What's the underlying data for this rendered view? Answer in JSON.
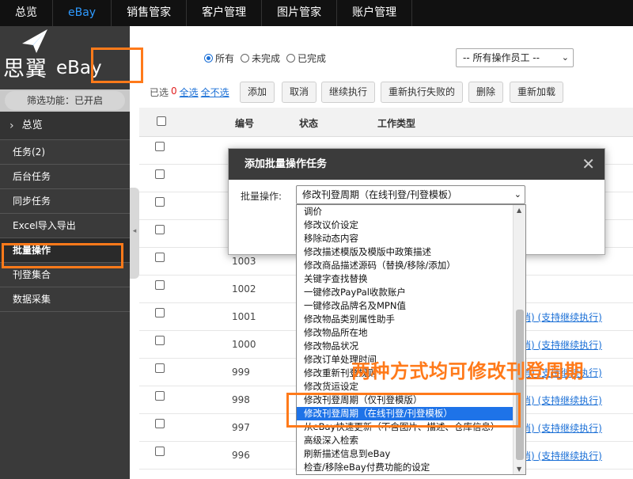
{
  "topnav": {
    "items": [
      "总览",
      "eBay",
      "销售管家",
      "客户管理",
      "图片管家",
      "账户管理"
    ],
    "active": "eBay"
  },
  "sidebar": {
    "logo_text": "思翼",
    "logo_ebay": "eBay",
    "filter": "筛选功能：已开启",
    "overview": "总览",
    "items": [
      "任务(2)",
      "后台任务",
      "同步任务",
      "Excel导入导出",
      "批量操作",
      "刊登集合",
      "数据采集"
    ],
    "active": "批量操作"
  },
  "filters": {
    "radios": [
      "所有",
      "未完成",
      "已完成"
    ],
    "selected_radio": "所有",
    "staff_select": "-- 所有操作员工 --"
  },
  "toolbar": {
    "selected_label": "已选",
    "selected_count": "0",
    "select_all": "全选",
    "select_none": "全不选",
    "buttons": [
      "添加",
      "取消",
      "继续执行",
      "重新执行失败的",
      "删除",
      "重新加载"
    ]
  },
  "table": {
    "headers": [
      "编号",
      "状态",
      "工作类型"
    ],
    "rows": [
      {
        "num": "",
        "actions": ""
      },
      {
        "num": "",
        "actions": ""
      },
      {
        "num": "",
        "actions": ""
      },
      {
        "num": "",
        "actions": ""
      },
      {
        "num": "1003",
        "actions": ""
      },
      {
        "num": "1002",
        "actions": ""
      },
      {
        "num": "1001",
        "actions": "取消) (支持继续执行)"
      },
      {
        "num": "1000",
        "actions": "取消) (支持继续执行)"
      },
      {
        "num": "999",
        "actions": "取消) (支持继续执行)"
      },
      {
        "num": "998",
        "actions": "取消) (支持继续执行)"
      },
      {
        "num": "997",
        "actions": "取消) (支持继续执行)"
      },
      {
        "num": "996",
        "actions": "取消) (支持继续执行)"
      }
    ]
  },
  "modal": {
    "title": "添加批量操作任务",
    "label": "批量操作:",
    "selected": "修改刊登周期（在线刊登/刊登模板）"
  },
  "dropdown": {
    "options": [
      "调价",
      "修改议价设定",
      "移除动态内容",
      "修改描述模版及模版中政策描述",
      "修改商品描述源码（替换/移除/添加）",
      "关键字查找替换",
      "一键修改PayPal收款账户",
      "一键修改品牌名及MPN值",
      "修改物品类别属性助手",
      "修改物品所在地",
      "修改物品状况",
      "修改订单处理时间",
      "修改重新刊登规则",
      "修改货运设定",
      "修改刊登周期（仅刊登模版）",
      "修改刊登周期（在线刊登/刊登模板）",
      "从eBay快速更新（不含图片、描述、仓库信息）",
      "高级深入检索",
      "刷新描述信息到eBay",
      "检查/移除eBay付费功能的设定"
    ],
    "selected_index": 15
  },
  "annotation": "两种方式均可修改刊登周期",
  "colors": {
    "highlight": "#ff7a1a",
    "link": "#1a6fd6",
    "selected_option": "#1e73e8"
  }
}
